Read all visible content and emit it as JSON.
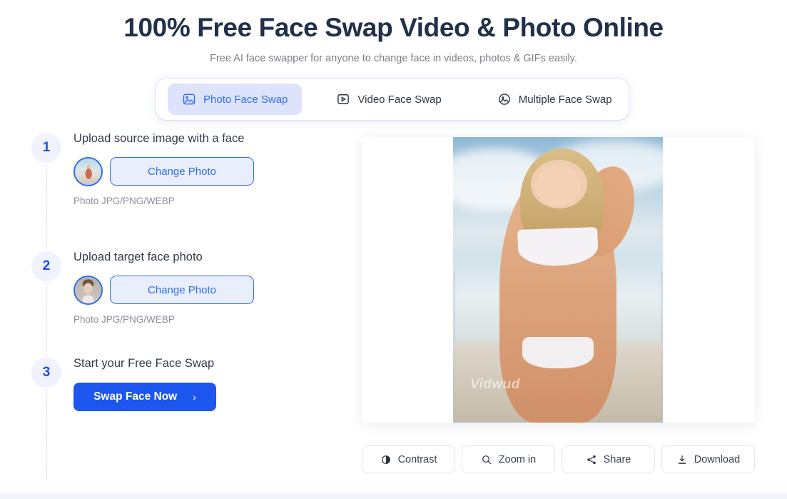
{
  "hero": {
    "title": "100% Free Face Swap Video & Photo Online",
    "subtitle": "Free AI face swapper for anyone to change face in videos, photos & GIFs easily."
  },
  "tabs": [
    {
      "label": "Photo Face Swap",
      "icon": "photo-icon",
      "active": true
    },
    {
      "label": "Video Face Swap",
      "icon": "video-icon",
      "active": false
    },
    {
      "label": "Multiple Face Swap",
      "icon": "multiple-photo-icon",
      "active": false
    }
  ],
  "steps": [
    {
      "number": "1",
      "title": "Upload source image with a face",
      "button": "Change Photo",
      "hint": "Photo JPG/PNG/WEBP",
      "thumbnail": "beach-photo-thumbnail"
    },
    {
      "number": "2",
      "title": "Upload target face photo",
      "button": "Change Photo",
      "hint": "Photo JPG/PNG/WEBP",
      "thumbnail": "portrait-face-thumbnail"
    },
    {
      "number": "3",
      "title": "Start your Free Face Swap",
      "button": "Swap Face Now",
      "button_chevron": "›"
    }
  ],
  "result": {
    "watermark": "Vidwud",
    "image_alt": "beach-photo-result"
  },
  "toolbar": [
    {
      "label": "Contrast",
      "icon": "contrast-icon"
    },
    {
      "label": "Zoom in",
      "icon": "search-icon"
    },
    {
      "label": "Share",
      "icon": "share-icon"
    },
    {
      "label": "Download",
      "icon": "download-icon"
    }
  ],
  "colors": {
    "accent": "#1d56ef",
    "accent_light": "#dce3fb",
    "title": "#22304a",
    "muted": "#8a8f99"
  }
}
